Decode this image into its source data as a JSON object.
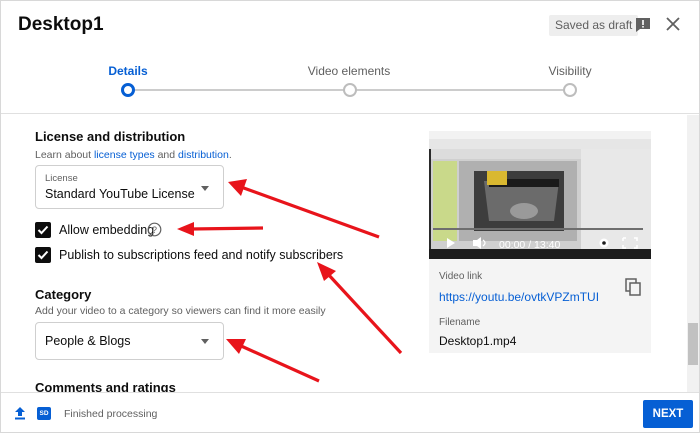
{
  "header": {
    "title": "Desktop1",
    "draft_badge": "Saved as draft"
  },
  "stepper": {
    "steps": [
      {
        "label": "Details"
      },
      {
        "label": "Video elements"
      },
      {
        "label": "Visibility"
      }
    ],
    "active_index": 0
  },
  "license_section": {
    "title": "License and distribution",
    "desc_prefix": "Learn about ",
    "link1": "license types",
    "desc_middle": " and ",
    "link2": "distribution",
    "desc_suffix": ".",
    "license_select": {
      "label": "License",
      "value": "Standard YouTube License"
    },
    "allow_embedding": {
      "label": "Allow embedding",
      "checked": true
    },
    "publish_feed": {
      "label": "Publish to subscriptions feed and notify subscribers",
      "checked": true
    }
  },
  "category_section": {
    "title": "Category",
    "desc": "Add your video to a category so viewers can find it more easily",
    "select_value": "People & Blogs"
  },
  "comments_section": {
    "title": "Comments and ratings"
  },
  "video_panel": {
    "time": "00:00 / 13:40",
    "link_label": "Video link",
    "link": "https://youtu.be/ovtkVPZmTUI",
    "filename_label": "Filename",
    "filename": "Desktop1.mp4"
  },
  "footer": {
    "status": "Finished processing",
    "sd_badge": "SD",
    "next_label": "NEXT"
  },
  "colors": {
    "accent": "#065fd4",
    "annotation_arrow": "#e8141b"
  }
}
